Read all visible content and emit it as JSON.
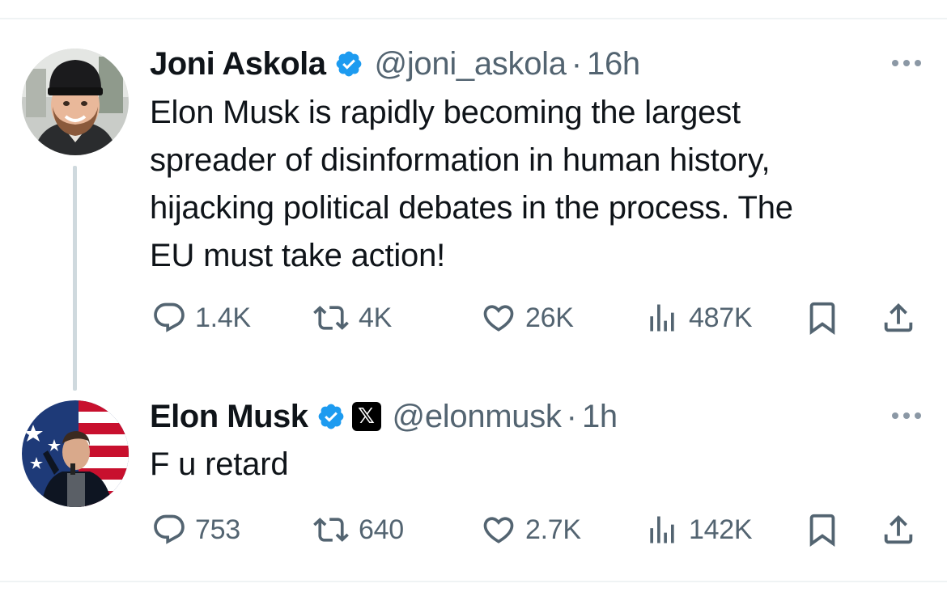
{
  "tweets": [
    {
      "author": "Joni Askola",
      "handle": "@joni_askola",
      "separator": "·",
      "time": "16h",
      "text_lines": [
        "Elon Musk is rapidly becoming the largest",
        "spreader of disinformation in human history,",
        "hijacking political debates in the process. The",
        "EU must take action!"
      ],
      "stats": {
        "replies": "1.4K",
        "reposts": "4K",
        "likes": "26K",
        "views": "487K"
      }
    },
    {
      "author": "Elon Musk",
      "handle": "@elonmusk",
      "affiliate_badge": "𝕏",
      "separator": "·",
      "time": "1h",
      "text_lines": [
        "F u retard"
      ],
      "stats": {
        "replies": "753",
        "reposts": "640",
        "likes": "2.7K",
        "views": "142K"
      }
    }
  ],
  "icons": {
    "verified": "verified-badge-icon",
    "more": "more-options-icon",
    "reply": "reply-icon",
    "repost": "repost-icon",
    "like": "like-icon",
    "views": "views-icon",
    "bookmark": "bookmark-icon",
    "share": "share-icon"
  },
  "colors": {
    "text": "#0f1419",
    "secondary": "#536471",
    "verified": "#1d9bf0",
    "divider": "#eff3f4",
    "thread_line": "#cfd9de"
  }
}
